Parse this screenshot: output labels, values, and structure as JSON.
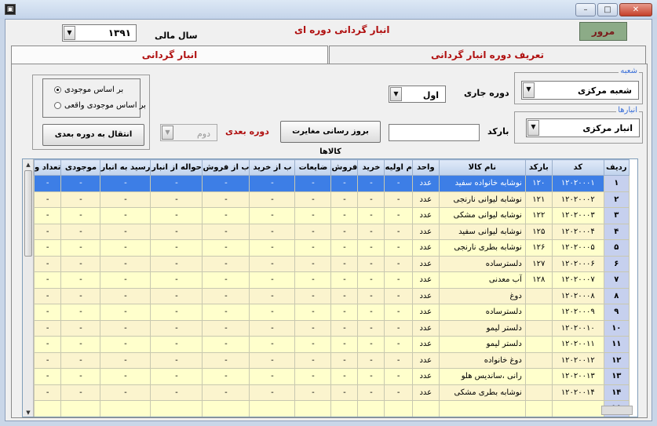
{
  "window": {
    "app_icon": "app-icon",
    "controls": [
      "minimize-icon",
      "maximize-icon",
      "close-icon"
    ],
    "minimize_glyph": "–",
    "maximize_glyph": "□",
    "close_glyph": "✕"
  },
  "header": {
    "browse_button": "مرور",
    "title": "انبار گردانی دوره ای",
    "year_label": "سال مالی",
    "year_value": "۱۳۹۱"
  },
  "tabs": [
    {
      "label": "تعریف دوره انبار گردانی",
      "active": false
    },
    {
      "label": "انبار گردانی",
      "active": true
    }
  ],
  "form": {
    "branch_legend": "شعبه",
    "branch_value": "شعبه مرکزی",
    "warehouse_legend": "انبارها",
    "warehouse_value": "انبار مرکزی",
    "current_period_label": "دوره جاری",
    "current_period_value": "اول",
    "barcode_label": "بارکد",
    "barcode_value": "",
    "update_button": "بروز رسانی مغایرت کالاها",
    "next_period_label": "دوره بعدی",
    "next_period_value": "دوم",
    "radio_stock": "بر اساس موجودی",
    "radio_actual": "بر اساس موجودی واقعی",
    "radio_selected": "stock",
    "move_button": "انتقال به دوره بعدی"
  },
  "grid": {
    "columns": [
      "ردیف",
      "کد",
      "بارکد",
      "نام کالا",
      "واحد",
      "م اولیه",
      "خرید",
      "فروش",
      "ضایعات",
      "ب از خرید",
      "ب از فروش",
      "حواله از انبار",
      "رسید به انبار",
      "موجودی",
      "تعداد و"
    ],
    "rows": [
      [
        "۱",
        "۱۲۰۲۰۰۰۱",
        "۱۲۰",
        "نوشابه خانواده سفید",
        "عدد",
        "-",
        "-",
        "-",
        "-",
        "-",
        "-",
        "-",
        "-",
        "-",
        "-"
      ],
      [
        "۲",
        "۱۲۰۲۰۰۰۲",
        "۱۲۱",
        "نوشابه لیوانی نارنجی",
        "عدد",
        "-",
        "-",
        "-",
        "-",
        "-",
        "-",
        "-",
        "-",
        "-",
        "-"
      ],
      [
        "۳",
        "۱۲۰۲۰۰۰۳",
        "۱۲۲",
        "نوشابه لیوانی مشکی",
        "عدد",
        "-",
        "-",
        "-",
        "-",
        "-",
        "-",
        "-",
        "-",
        "-",
        "-"
      ],
      [
        "۴",
        "۱۲۰۲۰۰۰۴",
        "۱۲۵",
        "نوشابه لیوانی سفید",
        "عدد",
        "-",
        "-",
        "-",
        "-",
        "-",
        "-",
        "-",
        "-",
        "-",
        "-"
      ],
      [
        "۵",
        "۱۲۰۲۰۰۰۵",
        "۱۲۶",
        "نوشابه بطری نارنجی",
        "عدد",
        "-",
        "-",
        "-",
        "-",
        "-",
        "-",
        "-",
        "-",
        "-",
        "-"
      ],
      [
        "۶",
        "۱۲۰۲۰۰۰۶",
        "۱۲۷",
        "دلسترساده",
        "عدد",
        "-",
        "-",
        "-",
        "-",
        "-",
        "-",
        "-",
        "-",
        "-",
        "-"
      ],
      [
        "۷",
        "۱۲۰۲۰۰۰۷",
        "۱۲۸",
        "آب معدنی",
        "عدد",
        "-",
        "-",
        "-",
        "-",
        "-",
        "-",
        "-",
        "-",
        "-",
        "-"
      ],
      [
        "۸",
        "۱۲۰۲۰۰۰۸",
        "",
        "دوغ",
        "عدد",
        "-",
        "-",
        "-",
        "-",
        "-",
        "-",
        "-",
        "-",
        "-",
        "-"
      ],
      [
        "۹",
        "۱۲۰۲۰۰۰۹",
        "",
        "دلسترساده",
        "عدد",
        "-",
        "-",
        "-",
        "-",
        "-",
        "-",
        "-",
        "-",
        "-",
        "-"
      ],
      [
        "۱۰",
        "۱۲۰۲۰۰۱۰",
        "",
        "دلستر لیمو",
        "عدد",
        "-",
        "-",
        "-",
        "-",
        "-",
        "-",
        "-",
        "-",
        "-",
        "-"
      ],
      [
        "۱۱",
        "۱۲۰۲۰۰۱۱",
        "",
        "دلستر لیمو",
        "عدد",
        "-",
        "-",
        "-",
        "-",
        "-",
        "-",
        "-",
        "-",
        "-",
        "-"
      ],
      [
        "۱۲",
        "۱۲۰۲۰۰۱۲",
        "",
        "دوغ خانواده",
        "عدد",
        "-",
        "-",
        "-",
        "-",
        "-",
        "-",
        "-",
        "-",
        "-",
        "-"
      ],
      [
        "۱۳",
        "۱۲۰۲۰۰۱۳",
        "",
        "رانی ،ساندیس هلو",
        "عدد",
        "-",
        "-",
        "-",
        "-",
        "-",
        "-",
        "-",
        "-",
        "-",
        "-"
      ],
      [
        "۱۴",
        "۱۲۰۲۰۰۱۴",
        "",
        "نوشابه بطری مشکی",
        "عدد",
        "-",
        "-",
        "-",
        "-",
        "-",
        "-",
        "-",
        "-",
        "-",
        "-"
      ],
      [
        "۱۵",
        "",
        "",
        "",
        "",
        "",
        "",
        "",
        "",
        "",
        "",
        "",
        "",
        "",
        ""
      ]
    ],
    "selected_row": 0
  },
  "icons": {
    "dropdown": "chevron-down-icon",
    "dropdown_glyph": "▼",
    "scroll_up_glyph": "▲",
    "scroll_down_glyph": "▼"
  },
  "colors": {
    "title_red": "#b01010",
    "row_odd": "#ffffcc",
    "row_even": "#fbf4ce",
    "row_selected": "#3d7ee6",
    "rowno_bg": "#c6d0ee",
    "browse_button_bg": "#8cab87"
  }
}
